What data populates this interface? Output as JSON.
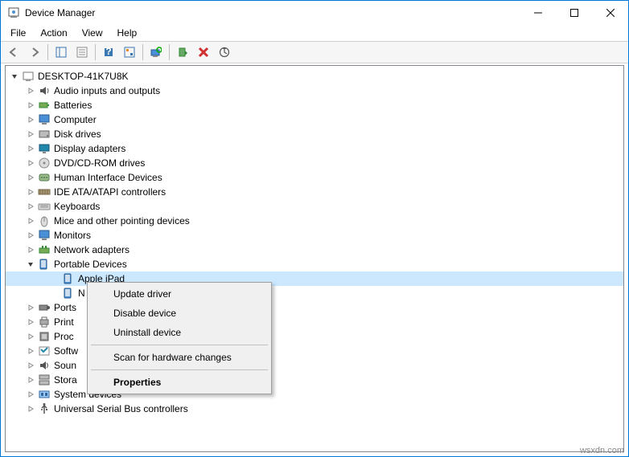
{
  "window": {
    "title": "Device Manager"
  },
  "menubar": {
    "items": [
      "File",
      "Action",
      "View",
      "Help"
    ]
  },
  "tree": {
    "root": "DESKTOP-41K7U8K",
    "categories": [
      {
        "label": "Audio inputs and outputs",
        "icon": "audio"
      },
      {
        "label": "Batteries",
        "icon": "battery"
      },
      {
        "label": "Computer",
        "icon": "computer"
      },
      {
        "label": "Disk drives",
        "icon": "disk"
      },
      {
        "label": "Display adapters",
        "icon": "display"
      },
      {
        "label": "DVD/CD-ROM drives",
        "icon": "dvd"
      },
      {
        "label": "Human Interface Devices",
        "icon": "hid"
      },
      {
        "label": "IDE ATA/ATAPI controllers",
        "icon": "ide"
      },
      {
        "label": "Keyboards",
        "icon": "keyboard"
      },
      {
        "label": "Mice and other pointing devices",
        "icon": "mouse"
      },
      {
        "label": "Monitors",
        "icon": "monitor"
      },
      {
        "label": "Network adapters",
        "icon": "network"
      },
      {
        "label": "Portable Devices",
        "icon": "portable",
        "expanded": true,
        "children": [
          {
            "label": "Apple iPad",
            "icon": "portable",
            "selected": true
          },
          {
            "label": "N",
            "icon": "portable"
          }
        ]
      },
      {
        "label": "Ports",
        "icon": "ports"
      },
      {
        "label": "Print",
        "icon": "print"
      },
      {
        "label": "Proc",
        "icon": "proc"
      },
      {
        "label": "Softw",
        "icon": "soft"
      },
      {
        "label": "Soun",
        "icon": "sound"
      },
      {
        "label": "Stora",
        "icon": "storage"
      },
      {
        "label": "System devices",
        "icon": "system"
      },
      {
        "label": "Universal Serial Bus controllers",
        "icon": "usb"
      }
    ]
  },
  "context_menu": {
    "items": [
      {
        "label": "Update driver",
        "sep": false
      },
      {
        "label": "Disable device",
        "sep": false
      },
      {
        "label": "Uninstall device",
        "sep": false
      },
      {
        "label": "",
        "sep": true
      },
      {
        "label": "Scan for hardware changes",
        "sep": false
      },
      {
        "label": "",
        "sep": true
      },
      {
        "label": "Properties",
        "sep": false,
        "bold": true
      }
    ]
  },
  "watermark": "wsxdn.com"
}
